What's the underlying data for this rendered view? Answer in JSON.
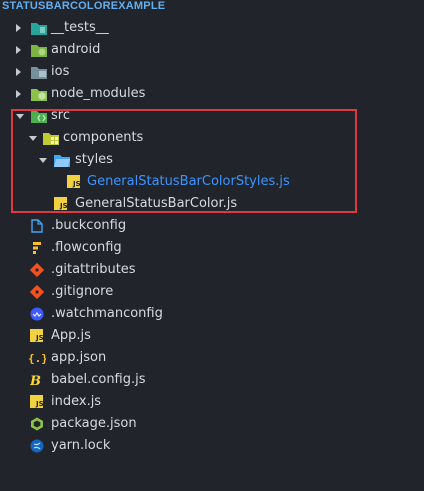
{
  "explorer": {
    "title": "STATUSBARCOLOREXAMPLE",
    "items": [
      {
        "label": "__tests__"
      },
      {
        "label": "android"
      },
      {
        "label": "ios"
      },
      {
        "label": "node_modules"
      },
      {
        "label": "src"
      },
      {
        "label": "components"
      },
      {
        "label": "styles"
      },
      {
        "label": "GeneralStatusBarColorStyles.js"
      },
      {
        "label": "GeneralStatusBarColor.js"
      },
      {
        "label": ".buckconfig"
      },
      {
        "label": ".flowconfig"
      },
      {
        "label": ".gitattributes"
      },
      {
        "label": ".gitignore"
      },
      {
        "label": ".watchmanconfig"
      },
      {
        "label": "App.js"
      },
      {
        "label": "app.json"
      },
      {
        "label": "babel.config.js"
      },
      {
        "label": "index.js"
      },
      {
        "label": "package.json"
      },
      {
        "label": "yarn.lock"
      }
    ]
  },
  "icons": {
    "__tests__": "folder-tests-icon",
    "android": "folder-android-icon",
    "ios": "folder-ios-icon",
    "node_modules": "folder-node-icon",
    "src": "folder-src-icon",
    "components": "folder-components-icon",
    "styles": "folder-styles-icon",
    "js": "js-file-icon",
    "buckconfig": "file-outline-icon",
    "flowconfig": "flow-icon",
    "git": "git-icon",
    "watchman": "watchman-icon",
    "json": "json-braces-icon",
    "babel": "babel-icon",
    "npm": "npm-icon",
    "yarn": "yarn-icon"
  },
  "colors": {
    "background": "#21252b",
    "text": "#d7dae0",
    "selected_text": "#3b94ff",
    "highlight_border": "#e0383e",
    "header": "#61afef"
  }
}
